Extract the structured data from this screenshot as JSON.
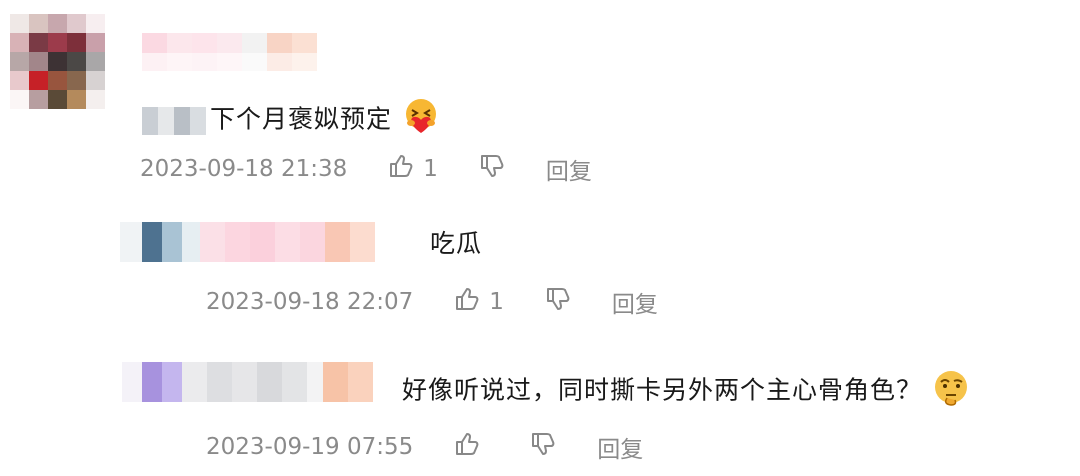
{
  "comments": [
    {
      "text": "下个月褒姒预定",
      "emoji_icon": "hug-heart-emoji",
      "time": "2023-09-18 21:38",
      "likes": "1",
      "reply_label": "回复"
    },
    {
      "text": "吃瓜",
      "time": "2023-09-18 22:07",
      "likes": "1",
      "reply_label": "回复"
    },
    {
      "text": "好像听说过，同时撕卡另外两个主心骨角色？",
      "emoji_icon": "thinking-emoji",
      "time": "2023-09-19 07:55",
      "likes": "",
      "reply_label": "回复"
    }
  ]
}
